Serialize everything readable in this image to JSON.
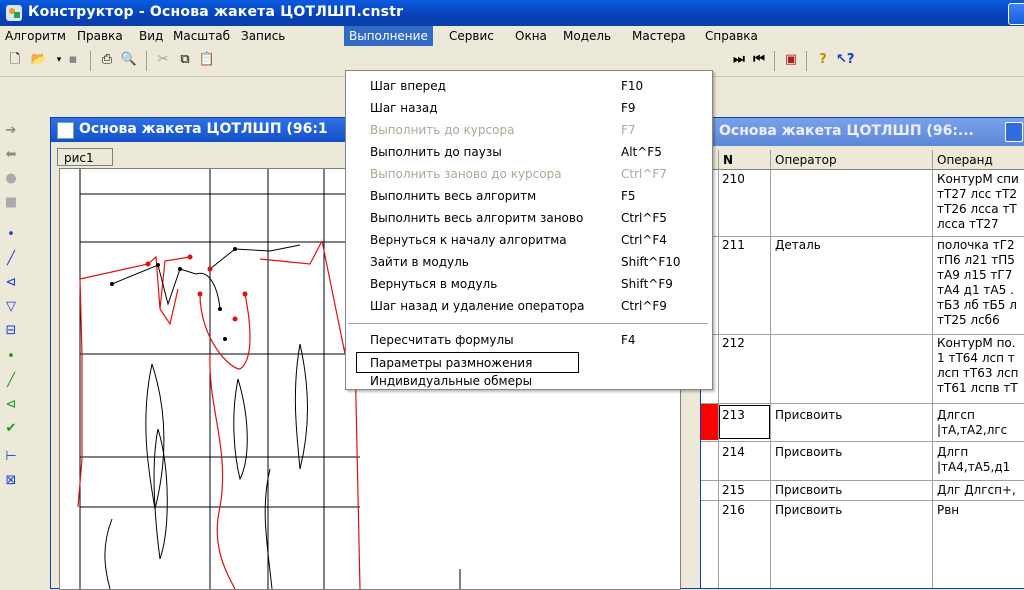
{
  "window_title": "Конструктор - Основа жакета ЦОТЛШП.cnstr",
  "menu": [
    "Алгоритм",
    "Правка",
    "Вид",
    "Масштаб",
    "Запись",
    "Выполнение",
    "Сервис",
    "Окна",
    "Модель",
    "Мастера",
    "Справка"
  ],
  "active_menu": "Выполнение",
  "dropdown": [
    {
      "label": "Шаг вперед",
      "key": "F10",
      "enabled": true
    },
    {
      "label": "Шаг назад",
      "key": "F9",
      "enabled": true
    },
    {
      "label": "Выполнить до курсора",
      "key": "F7",
      "enabled": false
    },
    {
      "label": "Выполнить до паузы",
      "key": "Alt^F5",
      "enabled": true
    },
    {
      "label": "Выполнить заново до курсора",
      "key": "Ctrl^F7",
      "enabled": false
    },
    {
      "label": "Выполнить весь алгоритм",
      "key": "F5",
      "enabled": true
    },
    {
      "label": "Выполнить весь алгоритм заново",
      "key": "Ctrl^F5",
      "enabled": true
    },
    {
      "label": "Вернуться к началу алгоритма",
      "key": "Ctrl^F4",
      "enabled": true
    },
    {
      "label": "Зайти в модуль",
      "key": "Shift^F10",
      "enabled": true
    },
    {
      "label": "Вернуться в модуль",
      "key": "Shift^F9",
      "enabled": true
    },
    {
      "label": "Шаг назад и удаление оператора",
      "key": "Ctrl^F9",
      "enabled": true
    },
    {
      "label": "Пересчитать формулы",
      "key": "F4",
      "enabled": true
    },
    {
      "label": "Параметры размножения",
      "key": "",
      "enabled": true
    },
    {
      "label": "Индивидуальные обмеры",
      "key": "",
      "enabled": true
    }
  ],
  "left_window": {
    "title": "Основа жакета ЦОТЛШП (96:1",
    "tab": "рис1"
  },
  "right_window": {
    "title": "Основа жакета ЦОТЛШП (96:...",
    "columns": [
      "N",
      "Оператор",
      "Операнд"
    ],
    "rows": [
      {
        "n": "210",
        "op": "",
        "operand": [
          "КонтурМ спи",
          "тТ27 лсс тТ2",
          "тТ26 лсса тТ",
          "лсса тТ27"
        ]
      },
      {
        "n": "211",
        "op": "Деталь",
        "operand": [
          "полочка тГ2",
          "тП6 л21 тП5",
          "тА9 л15 тГ7",
          "тА4 д1 тА5 .",
          "тБ3 лб тБ5 л",
          "тТ25 лсб6"
        ]
      },
      {
        "n": "212",
        "op": "",
        "operand": [
          "КонтурМ по.",
          "1 тТ64 лсп т",
          "лсп тТ63 лсп",
          "тТ61 лспв тТ"
        ]
      },
      {
        "n": "213",
        "op": "Присвоить",
        "operand": [
          "Длгсп",
          "|тА,тА2,лгс"
        ]
      },
      {
        "n": "214",
        "op": "Присвоить",
        "operand": [
          "Длгп",
          "|тА4,тА5,д1"
        ]
      },
      {
        "n": "215",
        "op": "Присвоить",
        "operand": [
          "Длг Длгсп+,"
        ]
      },
      {
        "n": "216",
        "op": "Присвоить",
        "operand": [
          "Рвн"
        ]
      }
    ]
  },
  "colors": {
    "selection": "#316ac5",
    "pattern_red": "#e01010",
    "current_row_marker": "#ff0000"
  }
}
